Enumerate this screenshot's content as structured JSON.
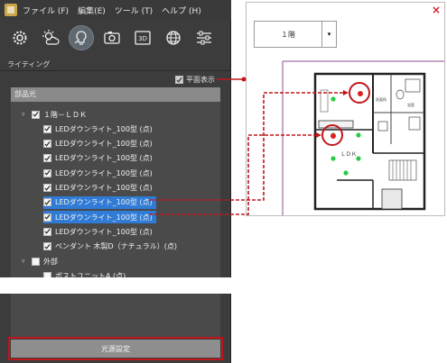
{
  "menubar": {
    "items": [
      "ファイル (F)",
      "編集(E)",
      "ツール (T)",
      "ヘルプ (H)"
    ]
  },
  "toolbar": {
    "tools": [
      "gear-icon",
      "weather-icon",
      "lighting-icon",
      "camera-icon",
      "3d-icon",
      "globe-icon",
      "sliders-icon"
    ],
    "active": "lighting-icon"
  },
  "panel": {
    "section_title": "ライティング",
    "plan_toggle_label": "平面表示",
    "parts_header": "部品光",
    "button_label": "光源設定"
  },
  "tree": [
    {
      "label": "１階－ＬＤＫ",
      "level": 0,
      "checked": true,
      "toggle": "▿",
      "selected": false
    },
    {
      "label": "LEDダウンライト_100型 (点)",
      "level": 1,
      "checked": true,
      "selected": false
    },
    {
      "label": "LEDダウンライト_100型 (点)",
      "level": 1,
      "checked": true,
      "selected": false
    },
    {
      "label": "LEDダウンライト_100型 (点)",
      "level": 1,
      "checked": true,
      "selected": false
    },
    {
      "label": "LEDダウンライト_100型 (点)",
      "level": 1,
      "checked": true,
      "selected": false
    },
    {
      "label": "LEDダウンライト_100型 (点)",
      "level": 1,
      "checked": true,
      "selected": false
    },
    {
      "label": "LEDダウンライト_100型 (点)",
      "level": 1,
      "checked": true,
      "selected": true
    },
    {
      "label": "LEDダウンライト_100型 (点)",
      "level": 1,
      "checked": true,
      "selected": true
    },
    {
      "label": "LEDダウンライト_100型 (点)",
      "level": 1,
      "checked": true,
      "selected": false
    },
    {
      "label": "ペンダント 木製D（ナチュラル）(点)",
      "level": 1,
      "checked": true,
      "selected": false
    },
    {
      "label": "外部",
      "level": 0,
      "checked": false,
      "toggle": "▿",
      "selected": false
    },
    {
      "label": "ポストユニットA (点)",
      "level": 1,
      "checked": false,
      "selected": false
    }
  ],
  "plan_window": {
    "close": "×",
    "floor_value": "１階",
    "room_labels": [
      "ＬＤＫ",
      "洗面所",
      "浴室"
    ]
  },
  "colors": {
    "highlight": "#c0161b",
    "selection": "#2f7bd5",
    "light_on": "#2cc84a"
  }
}
